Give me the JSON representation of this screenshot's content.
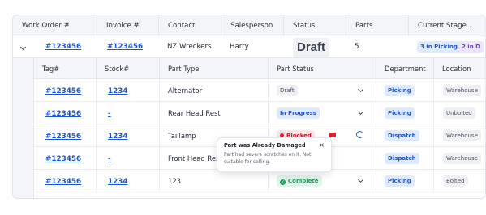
{
  "header": {
    "work_order": "Work Order #",
    "invoice": "Invoice #",
    "contact": "Contact",
    "salesperson": "Salesperson",
    "status": "Status",
    "parts": "Parts",
    "current_stage": "Current Stage..."
  },
  "order": {
    "work_order": "#123456",
    "invoice": "#123456",
    "contact": "NZ Wreckers",
    "salesperson": "Harry",
    "status": "Draft",
    "parts": "5",
    "stage_picking": "3 in Picking",
    "stage_other": "2 in D"
  },
  "parts_header": {
    "tag": "Tag#",
    "stock": "Stock#",
    "part_type": "Part Type",
    "part_status": "Part Status",
    "department": "Department",
    "location": "Location"
  },
  "parts": [
    {
      "tag": "#123456",
      "stock": "1234",
      "part_type": "Alternator",
      "status": "Draft",
      "department": "Picking",
      "location": "Warehouse"
    },
    {
      "tag": "#123456",
      "stock": "-",
      "part_type": "Rear Head Rest",
      "status": "In Progress",
      "department": "Picking",
      "location": "Unbolted"
    },
    {
      "tag": "#123456",
      "stock": "1234",
      "part_type": "Taillamp",
      "status": "Blocked",
      "department": "Dispatch",
      "location": "Warehouse"
    },
    {
      "tag": "#123456",
      "stock": "-",
      "part_type": "Front Head Rest",
      "status": "",
      "department": "Dispatch",
      "location": "Warehouse"
    },
    {
      "tag": "#123456",
      "stock": "1234",
      "part_type": "123",
      "status": "Complete",
      "department": "Picking",
      "location": "Bolted"
    }
  ],
  "tooltip": {
    "title": "Part was Already Damaged",
    "body": "Part had severe scratches on it. Not suitable for selling.",
    "close": "×"
  }
}
